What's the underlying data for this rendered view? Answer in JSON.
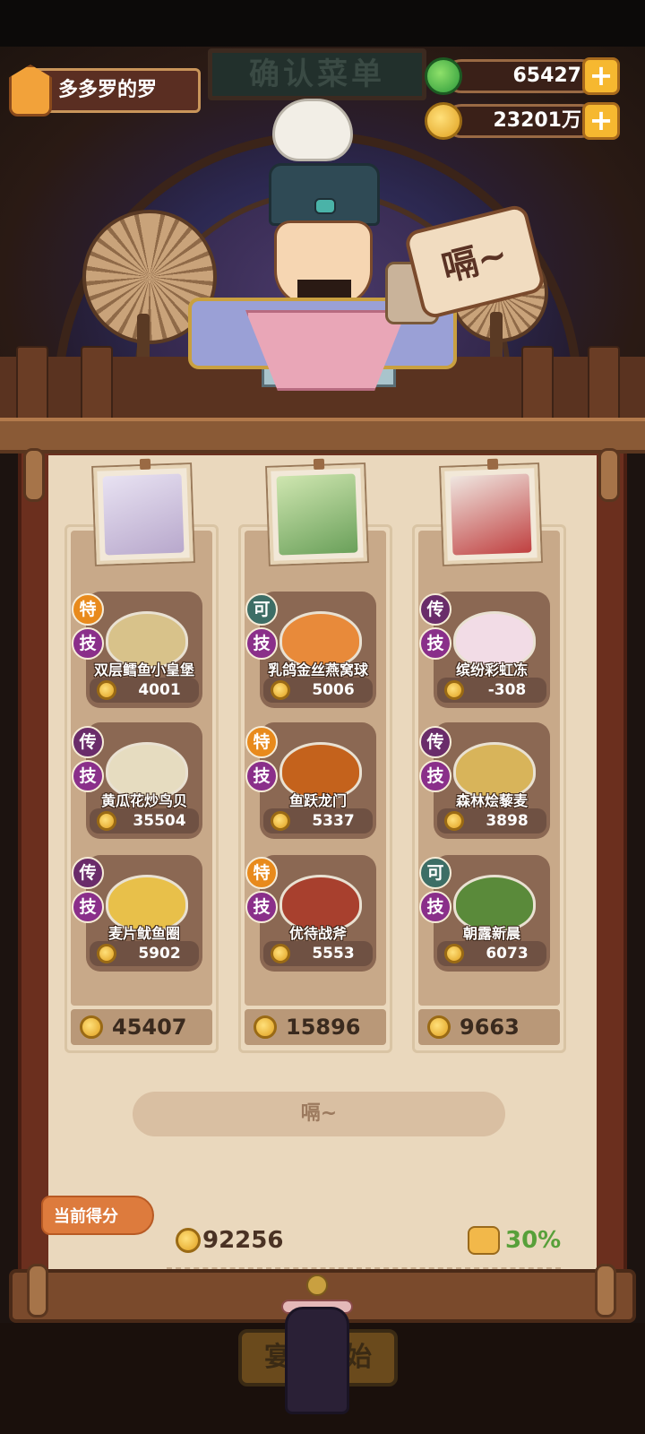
{
  "player": {
    "name": "多多罗的罗"
  },
  "resources": {
    "jade": {
      "value": "65427",
      "icon": "jade-icon"
    },
    "coins": {
      "value": "23201万",
      "icon": "coin-icon"
    },
    "plus_label": "+"
  },
  "scene": {
    "sign": "确认菜单",
    "speech": "嗝~"
  },
  "columns": [
    {
      "total": "45407",
      "dishes": [
        {
          "tag": "特",
          "skill": "技",
          "name": "双层鳕鱼小皇堡",
          "price": "4001"
        },
        {
          "tag": "传",
          "skill": "技",
          "name": "黄瓜花炒鸟贝",
          "price": "35504"
        },
        {
          "tag": "传",
          "skill": "技",
          "name": "麦片鱿鱼圈",
          "price": "5902"
        }
      ]
    },
    {
      "total": "15896",
      "dishes": [
        {
          "tag": "可",
          "skill": "技",
          "name": "乳鸽金丝燕窝球",
          "price": "5006"
        },
        {
          "tag": "特",
          "skill": "技",
          "name": "鱼跃龙门",
          "price": "5337"
        },
        {
          "tag": "特",
          "skill": "技",
          "name": "优待战斧",
          "price": "5553"
        }
      ]
    },
    {
      "total": "9663",
      "dishes": [
        {
          "tag": "传",
          "skill": "技",
          "name": "缤纷彩虹冻",
          "price": "-308"
        },
        {
          "tag": "传",
          "skill": "技",
          "name": "森林烩藜麦",
          "price": "3898"
        },
        {
          "tag": "可",
          "skill": "技",
          "name": "朝露新晨",
          "price": "6073"
        }
      ]
    }
  ],
  "say_button": "嗝~",
  "score": {
    "label": "当前得分",
    "value": "92256",
    "bonus": "30%"
  },
  "start_button": "宴会开始"
}
